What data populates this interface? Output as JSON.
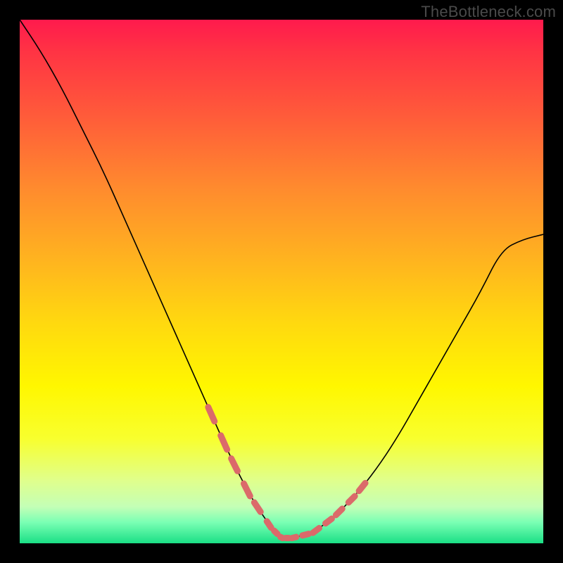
{
  "watermark": "TheBottleneck.com",
  "colors": {
    "background": "#000000",
    "curve": "#000000",
    "dashed_overlay": "#db6a6a",
    "gradient_top": "#ff1a4d",
    "gradient_bottom": "#1adf85"
  },
  "chart_data": {
    "type": "line",
    "title": "",
    "xlabel": "",
    "ylabel": "",
    "xlim": [
      0,
      100
    ],
    "ylim": [
      0,
      100
    ],
    "grid": false,
    "legend": false,
    "note": "Values read off a 100×100 normalized plot area; y=0 at bottom, y=100 at top. No axis ticks or labels are shown in the image.",
    "series": [
      {
        "name": "main-curve",
        "style": "solid",
        "color": "#000000",
        "x": [
          0,
          4,
          8,
          12,
          16,
          20,
          24,
          28,
          32,
          36,
          40,
          44,
          48,
          50,
          52,
          56,
          60,
          64,
          68,
          72,
          76,
          80,
          84,
          88,
          92,
          96,
          100
        ],
        "y": [
          100,
          94,
          87,
          79,
          71,
          62,
          53,
          44,
          35,
          26,
          17,
          9,
          3,
          1,
          1,
          2,
          5,
          9,
          14,
          20,
          27,
          34,
          41,
          48,
          56,
          58,
          59
        ]
      },
      {
        "name": "highlighted-segment",
        "style": "dashed",
        "color": "#db6a6a",
        "x": [
          36,
          40,
          44,
          48,
          50,
          52,
          56,
          60,
          64,
          68
        ],
        "y": [
          26,
          17,
          9,
          3,
          1,
          1,
          2,
          5,
          9,
          14
        ]
      }
    ]
  }
}
